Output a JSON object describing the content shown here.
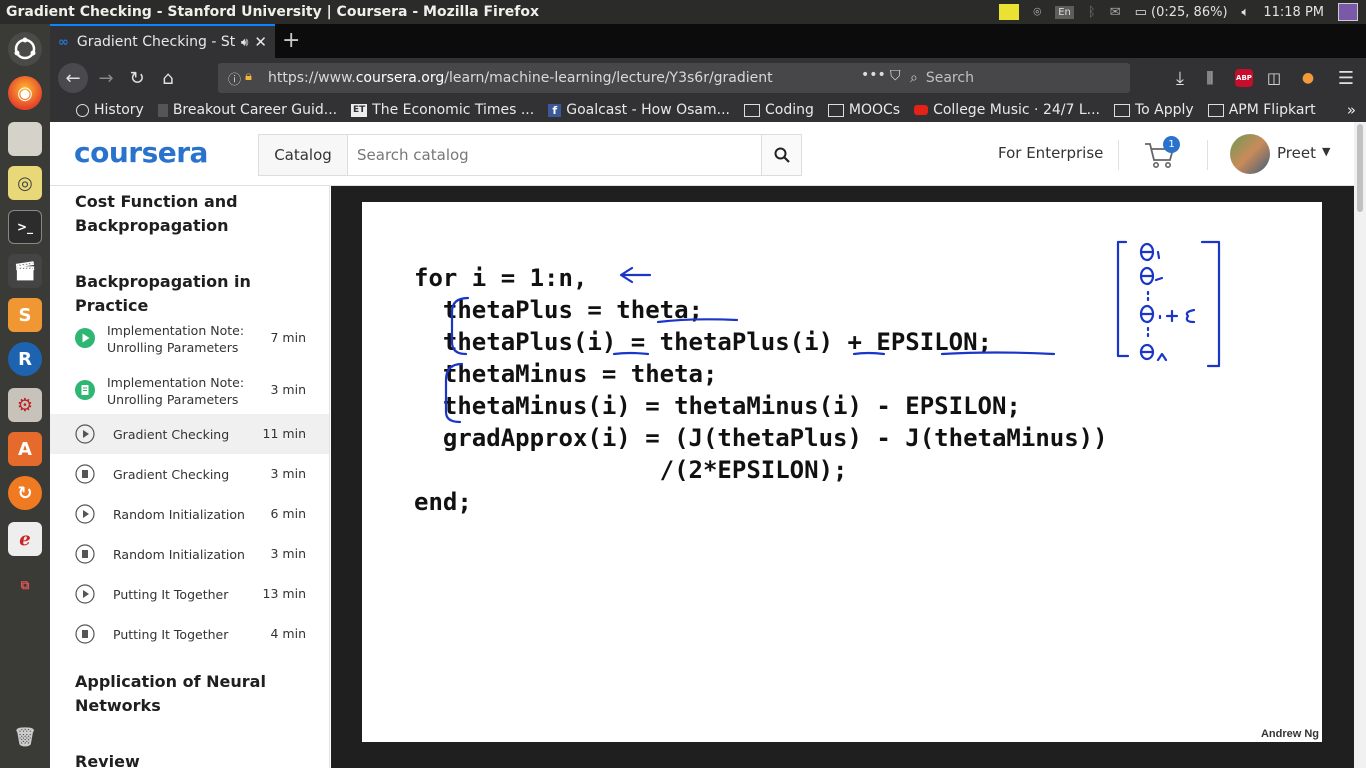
{
  "os": {
    "window_title": "Gradient Checking - Stanford University | Coursera - Mozilla Firefox",
    "keyboard_layout": "En",
    "battery": "(0:25, 86%)",
    "clock": "11:18 PM"
  },
  "browser": {
    "tab_title": "Gradient Checking - St",
    "url_prefix": "https://www.",
    "url_host": "coursera.org",
    "url_path": "/learn/machine-learning/lecture/Y3s6r/gradient",
    "search_placeholder": "Search",
    "bookmarks": [
      {
        "label": "History"
      },
      {
        "label": "Breakout Career Guid..."
      },
      {
        "label": "The Economic Times ..."
      },
      {
        "label": "Goalcast - How Osam..."
      },
      {
        "label": "Coding"
      },
      {
        "label": "MOOCs"
      },
      {
        "label": "College Music · 24/7 L..."
      },
      {
        "label": "To Apply"
      },
      {
        "label": "APM Flipkart"
      }
    ]
  },
  "header": {
    "logo": "coursera",
    "catalog_label": "Catalog",
    "search_placeholder": "Search catalog",
    "enterprise_label": "For Enterprise",
    "cart_count": "1",
    "user_name": "Preet"
  },
  "sidebar": {
    "section_prev": "Cost Function and Backpropagation",
    "section_current": "Backpropagation in Practice",
    "lessons": [
      {
        "title": "Implementation Note: Unrolling Parameters",
        "duration": "7 min",
        "type": "video-complete"
      },
      {
        "title": "Implementation Note: Unrolling Parameters",
        "duration": "3 min",
        "type": "reading-complete"
      },
      {
        "title": "Gradient Checking",
        "duration": "11 min",
        "type": "video"
      },
      {
        "title": "Gradient Checking",
        "duration": "3 min",
        "type": "reading"
      },
      {
        "title": "Random Initialization",
        "duration": "6 min",
        "type": "video"
      },
      {
        "title": "Random Initialization",
        "duration": "3 min",
        "type": "reading"
      },
      {
        "title": "Putting It Together",
        "duration": "13 min",
        "type": "video"
      },
      {
        "title": "Putting It Together",
        "duration": "4 min",
        "type": "reading"
      }
    ],
    "section_next": "Application of Neural Networks",
    "section_review": "Review"
  },
  "slide": {
    "code_lines": [
      "for i = 1:n,",
      "  thetaPlus = theta;",
      "  thetaPlus(i) = thetaPlus(i) + EPSILON;",
      "  thetaMinus = theta;",
      "  thetaMinus(i) = thetaMinus(i) - EPSILON;",
      "  gradApprox(i) = (J(thetaPlus) - J(thetaMinus))",
      "                 /(2*EPSILON);",
      "end;"
    ],
    "credit": "Andrew Ng",
    "ink_color": "#1a35c8"
  },
  "colors": {
    "coursera_blue": "#2a73cc",
    "complete_green": "#2fb673"
  }
}
